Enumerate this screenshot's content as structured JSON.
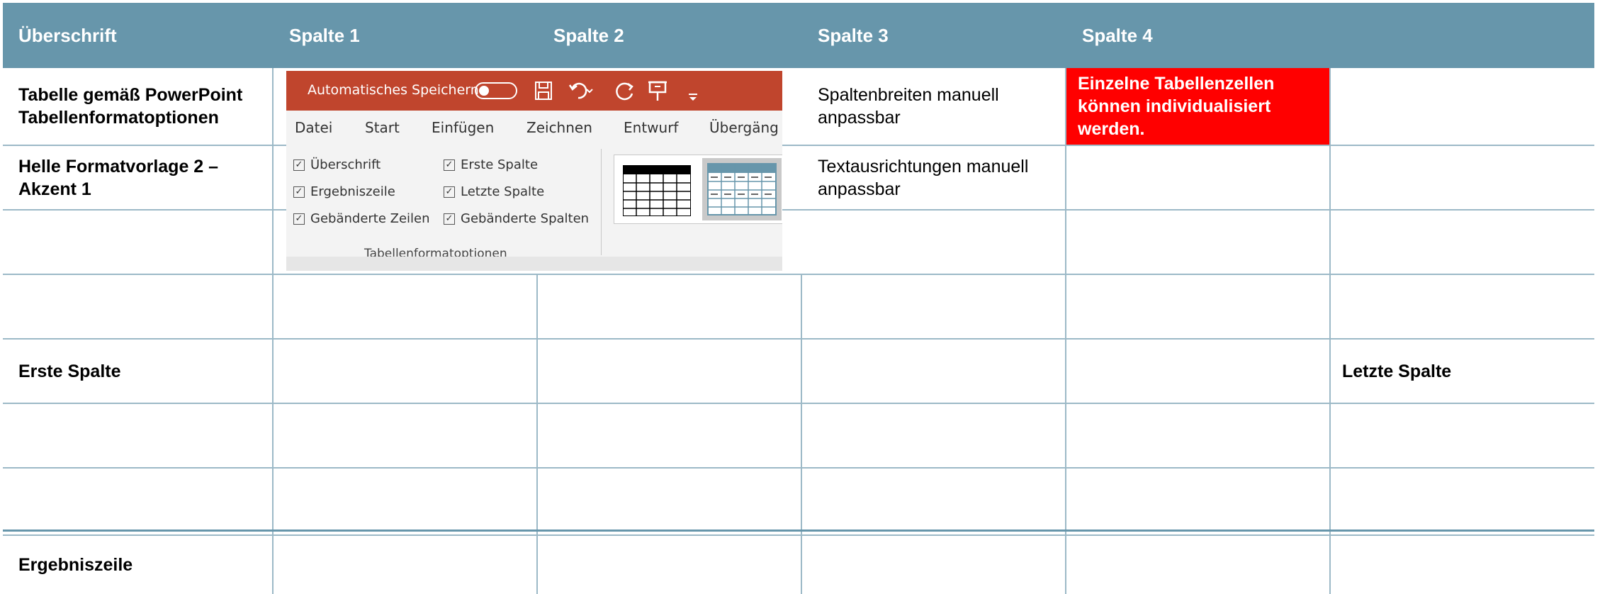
{
  "header": {
    "col0": "Überschrift",
    "col1": "Spalte 1",
    "col2": "Spalte 2",
    "col3": "Spalte 3",
    "col4": "Spalte 4"
  },
  "rows": {
    "r1c0": "Tabelle gemäß PowerPoint Tabellenformatoptionen",
    "r1c3": "Spaltenbreiten manuell anpassbar",
    "r1c4": "Einzelne Tabellenzellen können individualisiert werden.",
    "r2c0": "Helle Formatvorlage 2 – Akzent 1",
    "r2c3": "Textausrichtungen manuell anpassbar",
    "r5c0": "Erste Spalte",
    "r5c5": "Letzte Spalte",
    "total": "Ergebniszeile"
  },
  "colors": {
    "header_bg": "#6796ab",
    "gridline": "#9cb9c7",
    "highlight_cell": "#ff0000",
    "ribbon_title": "#c0452d"
  },
  "ribbon": {
    "autosave_label": "Automatisches Speichern",
    "icons": [
      "save-icon",
      "undo-icon",
      "redo-icon",
      "present-icon",
      "customize-icon"
    ],
    "menu": [
      "Datei",
      "Start",
      "Einfügen",
      "Zeichnen",
      "Entwurf",
      "Übergäng"
    ],
    "checkboxes": {
      "c1": "Überschrift",
      "c2": "Ergebniszeile",
      "c3": "Gebänderte Zeilen",
      "c4": "Erste Spalte",
      "c5": "Letzte Spalte",
      "c6": "Gebänderte Spalten"
    },
    "group_label": "Tabellenformatoptionen"
  }
}
